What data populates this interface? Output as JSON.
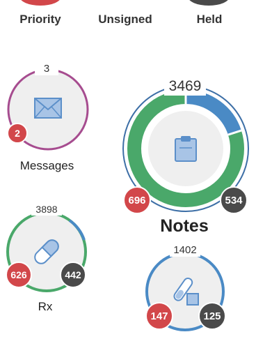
{
  "top_row": {
    "priority_label": "Priority",
    "unsigned_label": "Unsigned",
    "held_label": "Held",
    "priority_color": "#d2474a",
    "held_color": "#4a4a4a"
  },
  "messages": {
    "label": "Messages",
    "total": "3",
    "badge_red": "2",
    "icon": "envelope-icon",
    "ring_color": "#a64c8f"
  },
  "notes": {
    "label": "Notes",
    "total": "3469",
    "badge_red": "696",
    "badge_dark": "534",
    "icon": "clipboard-icon",
    "segments": [
      {
        "color": "#4a8ac5",
        "fraction": 0.2
      },
      {
        "color": "#4aa86a",
        "fraction": 0.8
      }
    ],
    "ring_color": "#3d6fa6"
  },
  "rx": {
    "label": "Rx",
    "total": "3898",
    "badge_red": "626",
    "badge_dark": "442",
    "icon": "pill-icon",
    "ring_color": "#4aa86a",
    "accent_color": "#4a8ac5"
  },
  "labs": {
    "total": "1402",
    "badge_red": "147",
    "badge_dark": "125",
    "icon": "test-tube-icon",
    "ring_color": "#4a8ac5"
  },
  "colors": {
    "badge_red": "#d2474a",
    "badge_dark": "#4a4a4a",
    "icon_blue": "#5b8fc9"
  }
}
